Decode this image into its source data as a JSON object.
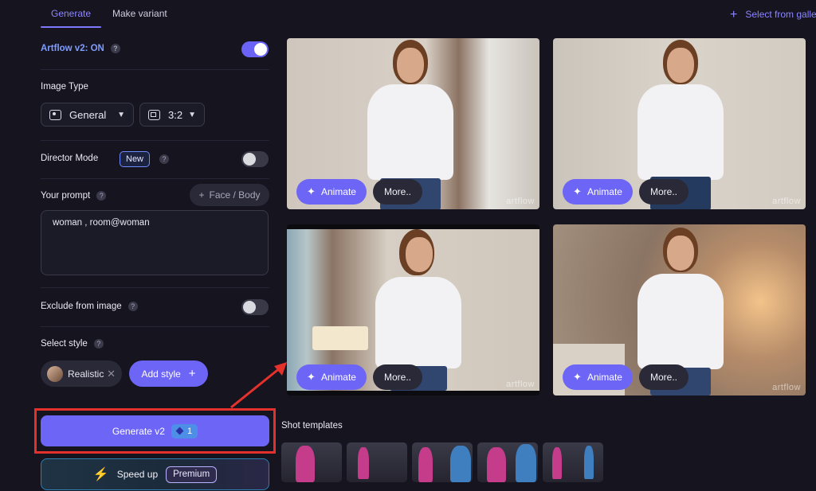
{
  "tabs": [
    {
      "label": "Generate"
    },
    {
      "label": "Make variant"
    }
  ],
  "gallery": {
    "label": "Select from gallery"
  },
  "artflow": {
    "label": "Artflow v2: ON",
    "enabled": true
  },
  "image_type": {
    "label": "Image Type",
    "type_value": "General",
    "ratio_value": "3:2"
  },
  "director": {
    "label": "Director Mode",
    "badge": "New",
    "enabled": false
  },
  "prompt": {
    "label": "Your prompt",
    "face_body_label": "Face / Body",
    "value": "woman , room@woman"
  },
  "exclude": {
    "label": "Exclude from image",
    "enabled": false
  },
  "style": {
    "label": "Select style",
    "selected": "Realistic",
    "add_label": "Add style"
  },
  "generate": {
    "label": "Generate v2",
    "count": "1"
  },
  "speed": {
    "label": "Speed up",
    "badge": "Premium"
  },
  "images": [
    {
      "animate": "Animate",
      "more": "More..",
      "watermark": "artflow"
    },
    {
      "animate": "Animate",
      "more": "More..",
      "watermark": "artflow"
    },
    {
      "animate": "Animate",
      "more": "More..",
      "watermark": "artflow"
    },
    {
      "animate": "Animate",
      "more": "More..",
      "watermark": "artflow"
    }
  ],
  "shot_templates": {
    "label": "Shot templates"
  },
  "colors": {
    "accent": "#6d65f6",
    "highlight": "#e5312b"
  }
}
